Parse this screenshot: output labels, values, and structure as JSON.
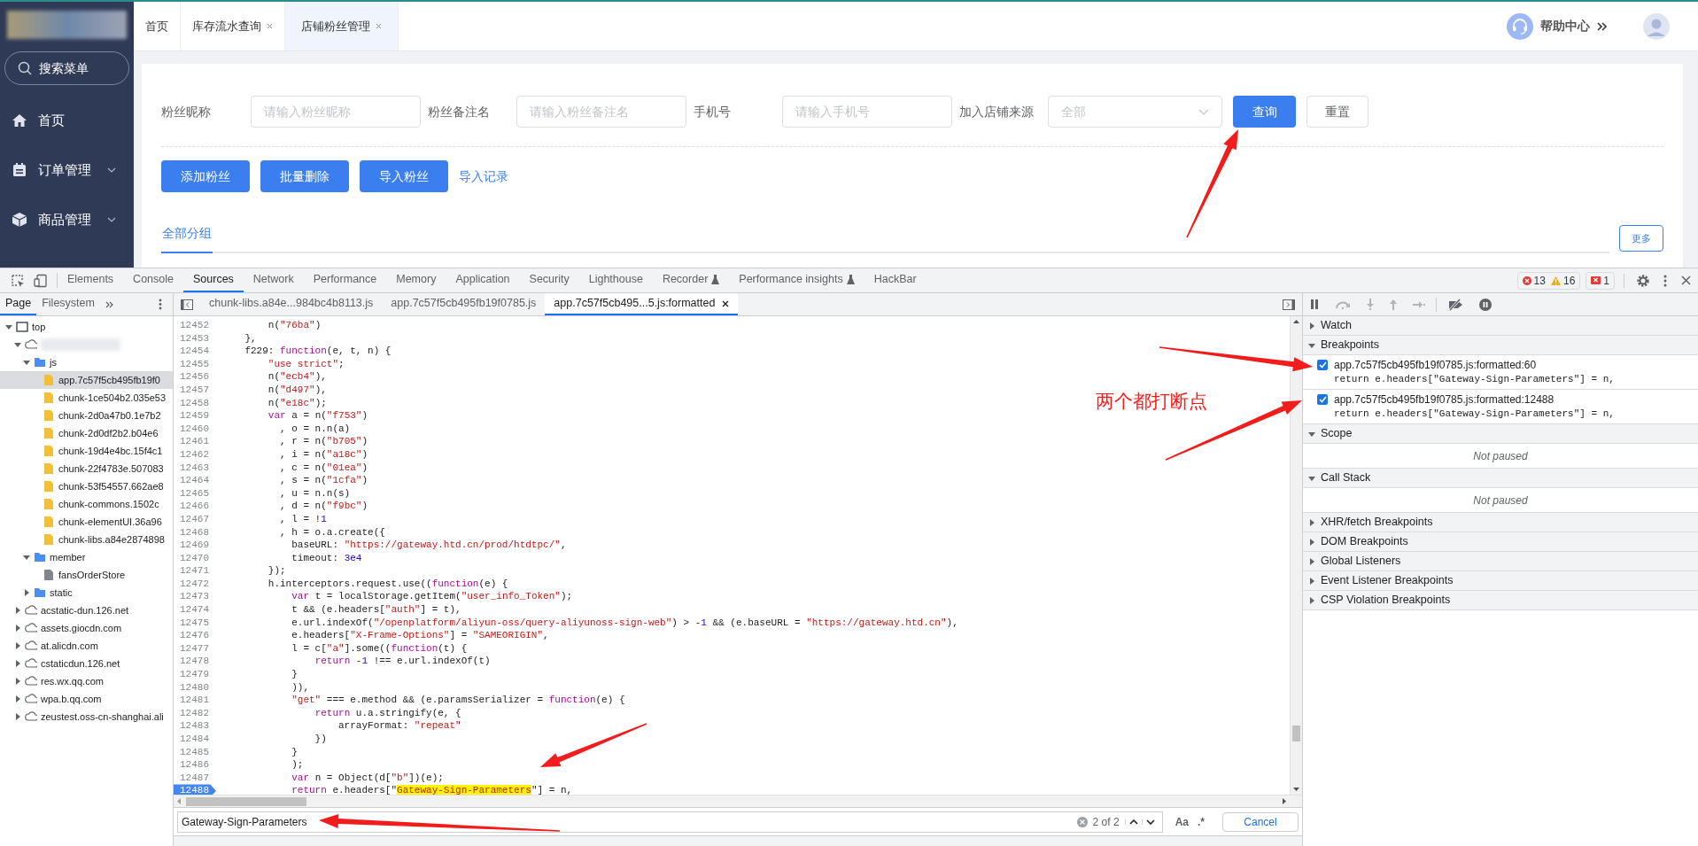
{
  "app": {
    "sidebar": {
      "search_label": "搜索菜单",
      "menu": [
        {
          "label": "首页",
          "expandable": false
        },
        {
          "label": "订单管理",
          "expandable": true
        },
        {
          "label": "商品管理",
          "expandable": true
        }
      ]
    },
    "tabs": [
      {
        "label": "首页",
        "closable": false,
        "selected": false
      },
      {
        "label": "库存流水查询",
        "closable": true,
        "selected": false
      },
      {
        "label": "店铺粉丝管理",
        "closable": true,
        "selected": true
      }
    ],
    "help_label": "帮助中心",
    "filters": [
      {
        "label": "粉丝昵称",
        "kind": "input",
        "placeholder": "请输入粉丝昵称"
      },
      {
        "label": "粉丝备注名",
        "kind": "input",
        "placeholder": "请输入粉丝备注名"
      },
      {
        "label": "手机号",
        "kind": "input",
        "placeholder": "请输入手机号"
      },
      {
        "label": "加入店铺来源",
        "kind": "select",
        "placeholder": "全部"
      }
    ],
    "filter_buttons": [
      {
        "label": "查询",
        "primary": true
      },
      {
        "label": "重置",
        "primary": false
      }
    ],
    "actions": [
      {
        "label": "添加粉丝",
        "kind": "button"
      },
      {
        "label": "批量删除",
        "kind": "button"
      },
      {
        "label": "导入粉丝",
        "kind": "button"
      },
      {
        "label": "导入记录",
        "kind": "link"
      }
    ],
    "groups": [
      {
        "label": "全部分组",
        "selected": true
      }
    ],
    "more_label": "更多"
  },
  "devtools": {
    "tabs": [
      {
        "label": "Elements",
        "selected": false,
        "experimental": false
      },
      {
        "label": "Console",
        "selected": false,
        "experimental": false
      },
      {
        "label": "Sources",
        "selected": true,
        "experimental": false
      },
      {
        "label": "Network",
        "selected": false,
        "experimental": false
      },
      {
        "label": "Performance",
        "selected": false,
        "experimental": false
      },
      {
        "label": "Memory",
        "selected": false,
        "experimental": false
      },
      {
        "label": "Application",
        "selected": false,
        "experimental": false
      },
      {
        "label": "Security",
        "selected": false,
        "experimental": false
      },
      {
        "label": "Lighthouse",
        "selected": false,
        "experimental": false
      },
      {
        "label": "Recorder",
        "selected": false,
        "experimental": true
      },
      {
        "label": "Performance insights",
        "selected": false,
        "experimental": true
      },
      {
        "label": "HackBar",
        "selected": false,
        "experimental": false
      }
    ],
    "errors": "13",
    "warnings": "16",
    "issues": "1",
    "nav_tabs": [
      {
        "label": "Page",
        "selected": true
      },
      {
        "label": "Filesystem",
        "selected": false
      }
    ],
    "tree": [
      {
        "label": "top",
        "kind": "frame",
        "expanded": true,
        "selected": false,
        "children": [
          {
            "kind": "domain",
            "obscured": true,
            "expanded": true,
            "selected": false,
            "children": [
              {
                "label": "js",
                "kind": "folder",
                "expanded": true,
                "selected": false,
                "children": [
                  {
                    "label": "app.7c57f5cb495fb19f0",
                    "kind": "script",
                    "selected": true
                  },
                  {
                    "label": "chunk-1ce504b2.035e53",
                    "kind": "script",
                    "selected": false
                  },
                  {
                    "label": "chunk-2d0a47b0.1e7b2",
                    "kind": "script",
                    "selected": false
                  },
                  {
                    "label": "chunk-2d0df2b2.b04e6",
                    "kind": "script",
                    "selected": false
                  },
                  {
                    "label": "chunk-19d4e4bc.15f4c1",
                    "kind": "script",
                    "selected": false
                  },
                  {
                    "label": "chunk-22f4783e.507083",
                    "kind": "script",
                    "selected": false
                  },
                  {
                    "label": "chunk-53f54557.662ae8",
                    "kind": "script",
                    "selected": false
                  },
                  {
                    "label": "chunk-commons.1502c",
                    "kind": "script",
                    "selected": false
                  },
                  {
                    "label": "chunk-elementUI.36a96",
                    "kind": "script",
                    "selected": false
                  },
                  {
                    "label": "chunk-libs.a84e2874898",
                    "kind": "script",
                    "selected": false
                  }
                ]
              },
              {
                "label": "member",
                "kind": "folder",
                "expanded": true,
                "selected": false,
                "children": [
                  {
                    "label": "fansOrderStore",
                    "kind": "file",
                    "selected": false
                  }
                ]
              },
              {
                "label": "static",
                "kind": "folder",
                "expanded": false,
                "selected": false
              }
            ]
          },
          {
            "label": "acstatic-dun.126.net",
            "kind": "domain",
            "expanded": false,
            "selected": false
          },
          {
            "label": "assets.giocdn.com",
            "kind": "domain",
            "expanded": false,
            "selected": false
          },
          {
            "label": "at.alicdn.com",
            "kind": "domain",
            "expanded": false,
            "selected": false
          },
          {
            "label": "cstaticdun.126.net",
            "kind": "domain",
            "expanded": false,
            "selected": false
          },
          {
            "label": "res.wx.qq.com",
            "kind": "domain",
            "expanded": false,
            "selected": false
          },
          {
            "label": "wpa.b.qq.com",
            "kind": "domain",
            "expanded": false,
            "selected": false
          },
          {
            "label": "zeustest.oss-cn-shanghai.ali",
            "kind": "domain",
            "expanded": false,
            "selected": false
          }
        ]
      }
    ],
    "editor_tabs": [
      {
        "label": "chunk-libs.a84e...984bc4b8113.js",
        "selected": false,
        "closable": false
      },
      {
        "label": "app.7c57f5cb495fb19f0785.js",
        "selected": false,
        "closable": false
      },
      {
        "label": "app.7c57f5cb495...5.js:formatted",
        "selected": true,
        "closable": true
      }
    ],
    "code": [
      {
        "n": "12452",
        "code": "        n(\"76ba\")"
      },
      {
        "n": "12453",
        "code": "    },"
      },
      {
        "n": "12454",
        "code": "    f229: function(e, t, n) {"
      },
      {
        "n": "12455",
        "code": "        \"use strict\";"
      },
      {
        "n": "12456",
        "code": "        n(\"ecb4\"),"
      },
      {
        "n": "12457",
        "code": "        n(\"d497\"),"
      },
      {
        "n": "12458",
        "code": "        n(\"e18c\");"
      },
      {
        "n": "12459",
        "code": "        var a = n(\"f753\")"
      },
      {
        "n": "12460",
        "code": "          , o = n.n(a)"
      },
      {
        "n": "12461",
        "code": "          , r = n(\"b705\")"
      },
      {
        "n": "12462",
        "code": "          , i = n(\"a18c\")"
      },
      {
        "n": "12463",
        "code": "          , c = n(\"01ea\")"
      },
      {
        "n": "12464",
        "code": "          , s = n(\"1cfa\")"
      },
      {
        "n": "12465",
        "code": "          , u = n.n(s)"
      },
      {
        "n": "12466",
        "code": "          , d = n(\"f9bc\")"
      },
      {
        "n": "12467",
        "code": "          , l = !1"
      },
      {
        "n": "12468",
        "code": "          , h = o.a.create({"
      },
      {
        "n": "12469",
        "code": "            baseURL: \"https://gateway.htd.cn/prod/htdtpc/\","
      },
      {
        "n": "12470",
        "code": "            timeout: 3e4"
      },
      {
        "n": "12471",
        "code": "        });"
      },
      {
        "n": "12472",
        "code": "        h.interceptors.request.use((function(e) {"
      },
      {
        "n": "12473",
        "code": "            var t = localStorage.getItem(\"user_info_Token\");"
      },
      {
        "n": "12474",
        "code": "            t && (e.headers[\"auth\"] = t),"
      },
      {
        "n": "12475",
        "code": "            e.url.indexOf(\"/openplatform/aliyun-oss/query-aliyunoss-sign-web\") > -1 && (e.baseURL = \"https://gateway.htd.cn\"),"
      },
      {
        "n": "12476",
        "code": "            e.headers[\"X-Frame-Options\"] = \"SAMEORIGIN\","
      },
      {
        "n": "12477",
        "code": "            l = c[\"a\"].some((function(t) {"
      },
      {
        "n": "12478",
        "code": "                return -1 !== e.url.indexOf(t)"
      },
      {
        "n": "12479",
        "code": "            }"
      },
      {
        "n": "12480",
        "code": "            )),"
      },
      {
        "n": "12481",
        "code": "            \"get\" === e.method && (e.paramsSerializer = function(e) {"
      },
      {
        "n": "12482",
        "code": "                return u.a.stringify(e, {"
      },
      {
        "n": "12483",
        "code": "                    arrayFormat: \"repeat\""
      },
      {
        "n": "12484",
        "code": "                })"
      },
      {
        "n": "12485",
        "code": "            }"
      },
      {
        "n": "12486",
        "code": "            );"
      },
      {
        "n": "12487",
        "code": "            var n = Object(d[\"b\"])(e);"
      },
      {
        "n": "12488",
        "breakpoint": true,
        "code_before": "            return e.headers[\"",
        "match": "Gateway-Sign-Parameters",
        "code_after": "\"] = n,"
      }
    ],
    "search": {
      "value": "Gateway-Sign-Parameters",
      "count": "2 of 2",
      "case_label": "Aa",
      "regex_label": ".*",
      "cancel": "Cancel"
    },
    "sections": [
      {
        "title": "Watch",
        "expanded": false
      },
      {
        "title": "Breakpoints",
        "expanded": true,
        "kind": "breakpoints",
        "items": [
          {
            "location": "app.7c57f5cb495fb19f0785.js:formatted:60",
            "code": "return e.headers[\"Gateway-Sign-Parameters\"] = n,",
            "checked": true
          },
          {
            "location": "app.7c57f5cb495fb19f0785.js:formatted:12488",
            "code": "return e.headers[\"Gateway-Sign-Parameters\"] = n,",
            "checked": true
          }
        ]
      },
      {
        "title": "Scope",
        "expanded": true,
        "kind": "message",
        "message": "Not paused"
      },
      {
        "title": "Call Stack",
        "expanded": true,
        "kind": "message",
        "message": "Not paused"
      },
      {
        "title": "XHR/fetch Breakpoints",
        "expanded": false
      },
      {
        "title": "DOM Breakpoints",
        "expanded": false
      },
      {
        "title": "Global Listeners",
        "expanded": false
      },
      {
        "title": "Event Listener Breakpoints",
        "expanded": false
      },
      {
        "title": "CSP Violation Breakpoints",
        "expanded": false
      }
    ]
  },
  "annotation": {
    "text": "两个都打断点"
  }
}
